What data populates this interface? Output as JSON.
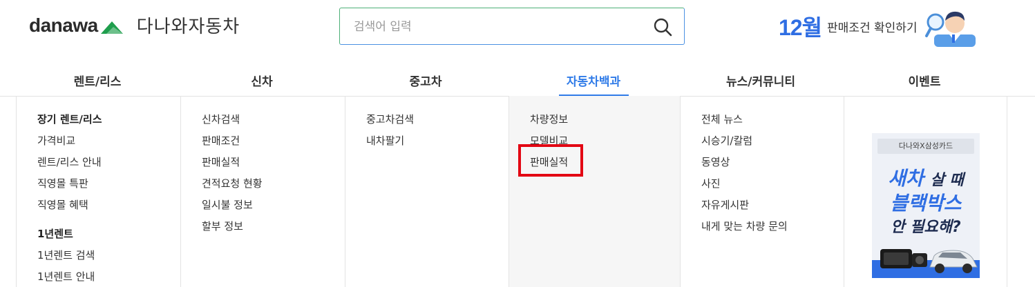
{
  "header": {
    "logo_en": "danawa",
    "logo_ko": "다나와자동차",
    "search": {
      "placeholder": "검색어 입력"
    },
    "promo": {
      "month": "12월",
      "text": "판매조건 확인하기"
    }
  },
  "nav": {
    "items": [
      {
        "label": "렌트/리스"
      },
      {
        "label": "신차"
      },
      {
        "label": "중고차"
      },
      {
        "label": "자동차백과",
        "active": true
      },
      {
        "label": "뉴스/커뮤니티"
      },
      {
        "label": "이벤트"
      }
    ]
  },
  "menu": {
    "rent": {
      "head1": "장기 렌트/리스",
      "items1": [
        "가격비교",
        "렌트/리스 안내",
        "직영몰 특판",
        "직영몰 혜택"
      ],
      "head2": "1년렌트",
      "items2": [
        "1년렌트 검색",
        "1년렌트 안내"
      ]
    },
    "newcar": [
      "신차검색",
      "판매조건",
      "판매실적",
      "견적요청 현황",
      "일시불 정보",
      "할부 정보"
    ],
    "usedcar": [
      "중고차검색",
      "내차팔기"
    ],
    "encyclopedia": [
      "차량정보",
      "모델비교",
      "판매실적"
    ],
    "news": [
      "전체 뉴스",
      "시승기/칼럼",
      "동영상",
      "사진",
      "자유게시판",
      "내게 맞는 차량 문의"
    ]
  },
  "banner": {
    "tag": "다나와X삼성카드",
    "line1_a": "새차",
    "line1_b": "살 때",
    "line2": "블랙박스",
    "line3": "안 필요해?"
  },
  "colors": {
    "accent": "#2f7be8",
    "highlight": "#e30613",
    "brand_green": "#1f9e4d"
  }
}
